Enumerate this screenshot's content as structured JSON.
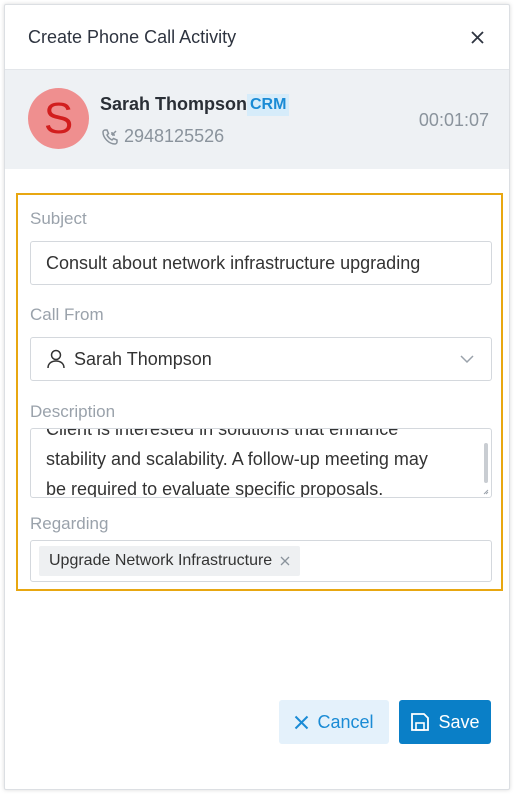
{
  "dialog": {
    "title": "Create Phone Call Activity",
    "close_icon": "close-icon"
  },
  "contact": {
    "avatar_letter": "S",
    "name": "Sarah Thompson",
    "badge": "CRM",
    "phone": "2948125526",
    "duration": "00:01:07"
  },
  "form": {
    "subject_label": "Subject",
    "subject_value": "Consult about network infrastructure upgrading",
    "call_from_label": "Call From",
    "call_from_value": "Sarah Thompson",
    "description_label": "Description",
    "description_lines": [
      "Client is interested in solutions that enhance",
      "stability and scalability. A follow-up meeting may",
      "be required to evaluate specific proposals."
    ],
    "regarding_label": "Regarding",
    "regarding_tag": "Upgrade Network Infrastructure"
  },
  "buttons": {
    "cancel": "Cancel",
    "save": "Save"
  },
  "colors": {
    "accent": "#0a7fc7",
    "highlight_border": "#e8a711",
    "avatar_bg": "#ef8f8f",
    "avatar_fg": "#d21e1e"
  }
}
